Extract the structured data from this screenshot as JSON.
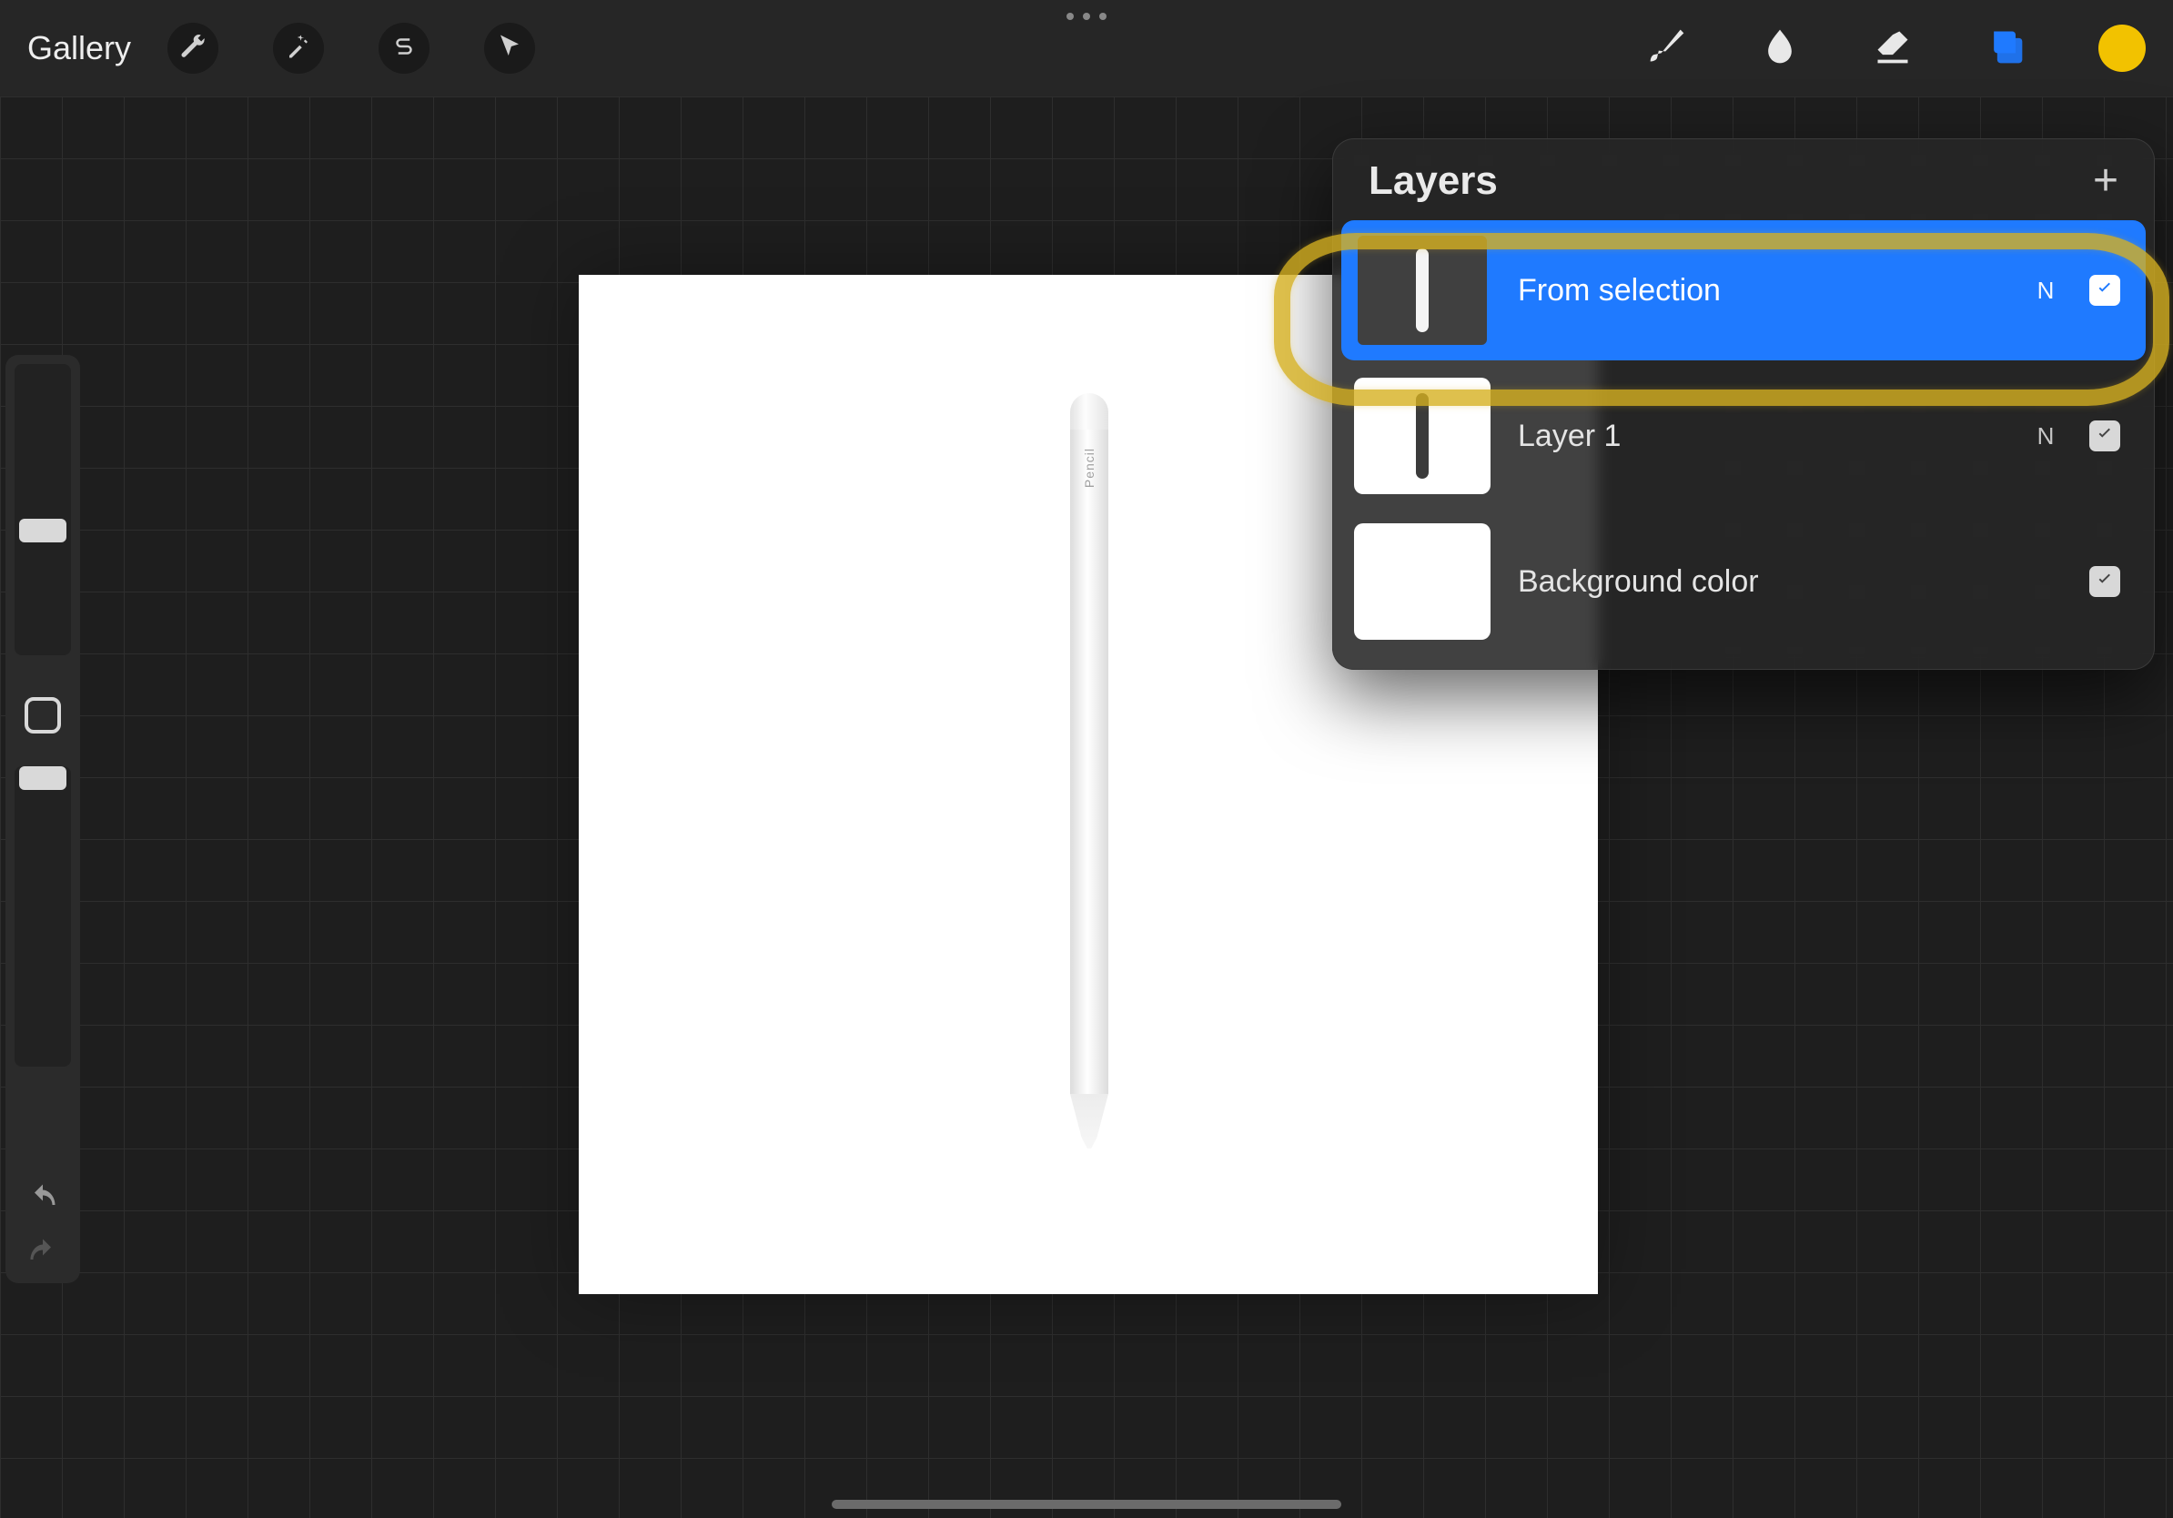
{
  "topbar": {
    "gallery_label": "Gallery"
  },
  "canvas": {
    "pencil_label": " Pencil"
  },
  "layers_panel": {
    "title": "Layers",
    "rows": [
      {
        "name": "From selection",
        "blend": "N",
        "selected": true,
        "thumb": "dark-white-stroke",
        "visible": true
      },
      {
        "name": "Layer 1",
        "blend": "N",
        "selected": false,
        "thumb": "white-dark-stroke",
        "visible": true
      },
      {
        "name": "Background color",
        "blend": "",
        "selected": false,
        "thumb": "white",
        "visible": true
      }
    ]
  },
  "colors": {
    "accent": "#1f7aff",
    "swatch": "#f2c200"
  }
}
